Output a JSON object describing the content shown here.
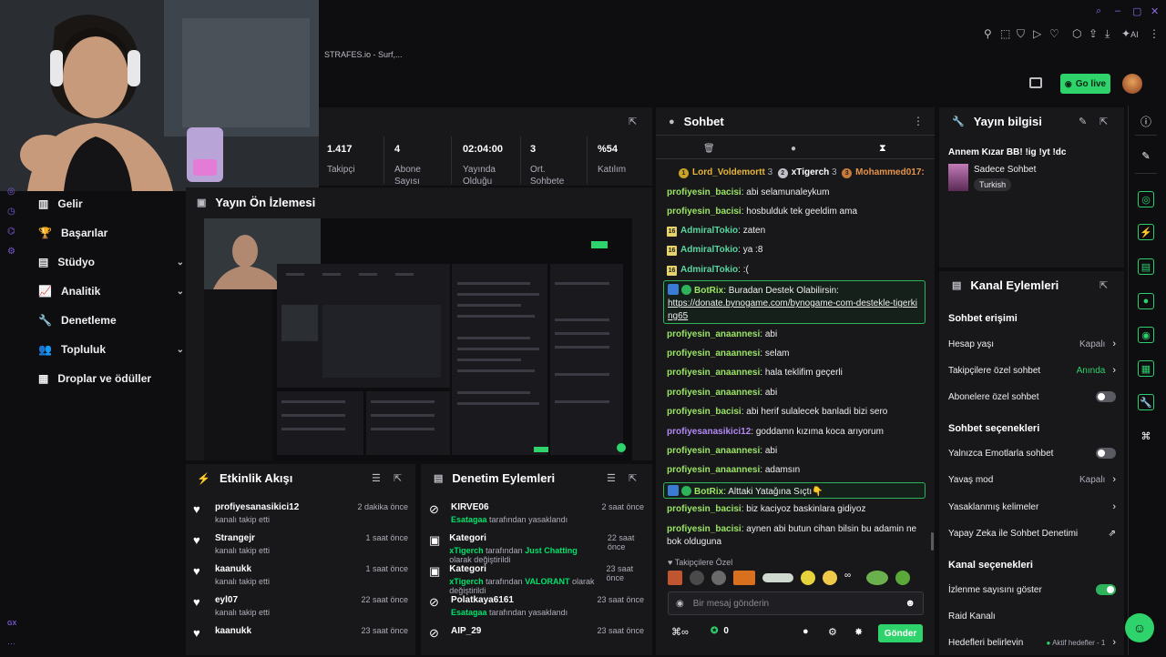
{
  "topbar": {
    "tab_title": "STRAFES.io - Surf,...",
    "ai_label": "AI",
    "go_live": "Go live"
  },
  "sidebar": {
    "items": [
      {
        "label": "Gelir",
        "icon": "bar-chart-icon"
      },
      {
        "label": "Başarılar",
        "icon": "trophy-icon"
      },
      {
        "label": "Stüdyo",
        "icon": "studio-icon"
      },
      {
        "label": "Analitik",
        "icon": "analytics-icon"
      },
      {
        "label": "Denetleme",
        "icon": "wrench-icon"
      },
      {
        "label": "Topluluk",
        "icon": "community-icon"
      },
      {
        "label": "Droplar ve ödüller",
        "icon": "gift-icon"
      }
    ],
    "footer": "GX"
  },
  "stats": [
    {
      "value": "1.417",
      "label": "Takipçi"
    },
    {
      "value": "4",
      "label": "Abone Sayısı"
    },
    {
      "value": "02:04:00",
      "label": "Yayında Olduğu"
    },
    {
      "value": "3",
      "label": "Ort. Sohbete"
    },
    {
      "value": "%54",
      "label": "Katılım"
    }
  ],
  "preview": {
    "title": "Yayın Ön İzlemesi"
  },
  "activity": {
    "title": "Etkinlik Akışı",
    "items": [
      {
        "name": "profiyesanasikici12",
        "action": "kanalı takip etti",
        "time": "2 dakika önce"
      },
      {
        "name": "Strangejr",
        "action": "kanalı takip etti",
        "time": "1 saat önce"
      },
      {
        "name": "kaanukk",
        "action": "kanalı takip etti",
        "time": "1 saat önce"
      },
      {
        "name": "eyl07",
        "action": "kanalı takip etti",
        "time": "22 saat önce"
      },
      {
        "name": "kaanukk",
        "action": "",
        "time": "23 saat önce"
      }
    ]
  },
  "moderation": {
    "title": "Denetim Eylemleri",
    "items": [
      {
        "name": "KIRVE06",
        "actor": "Esatagaa",
        "mid": " tarafından yasaklandı",
        "hl": "",
        "end": "",
        "time": "2 saat önce",
        "icon": "ban-icon"
      },
      {
        "name": "Kategori",
        "actor": "xTigerch",
        "mid": " tarafından ",
        "hl": "Just Chatting",
        "end": " olarak değiştirildi",
        "time": "22 saat önce",
        "icon": "category-icon"
      },
      {
        "name": "Kategori",
        "actor": "xTigerch",
        "mid": " tarafından ",
        "hl": "VALORANT",
        "end": " olarak değiştirildi",
        "time": "23 saat önce",
        "icon": "category-icon"
      },
      {
        "name": "Polatkaya6161",
        "actor": "Esatagaa",
        "mid": " tarafından yasaklandı",
        "hl": "",
        "end": "",
        "time": "23 saat önce",
        "icon": "ban-icon"
      },
      {
        "name": "AIP_29",
        "actor": "",
        "mid": "",
        "hl": "",
        "end": "",
        "time": "23 saat önce",
        "icon": "ban-icon"
      }
    ]
  },
  "chat": {
    "title": "Sohbet",
    "top_chatters": [
      {
        "rank": "1",
        "name": "Lord_Voldemortt",
        "count": "3"
      },
      {
        "rank": "2",
        "name": "xTigerch",
        "count": "3"
      },
      {
        "rank": "3",
        "name": "Mohammed017:",
        "count": ""
      }
    ],
    "messages": [
      {
        "user": "profiyesin_bacisi",
        "text": "abi selamunaleykum",
        "cls": "u1",
        "badge": ""
      },
      {
        "user": "profiyesin_bacisi",
        "text": "hosbulduk tek geeldim ama",
        "cls": "u1",
        "badge": ""
      },
      {
        "user": "AdmiralTokio",
        "text": "zaten",
        "cls": "u3",
        "badge": "16"
      },
      {
        "user": "AdmiralTokio",
        "text": "ya :8",
        "cls": "u3",
        "badge": "16"
      },
      {
        "user": "AdmiralTokio",
        "text": ":(",
        "cls": "u3",
        "badge": "16"
      },
      {
        "user": "profiyesin_anaannesi",
        "text": "abi",
        "cls": "u1",
        "badge": ""
      },
      {
        "user": "profiyesin_anaannesi",
        "text": "selam",
        "cls": "u1",
        "badge": ""
      },
      {
        "user": "profiyesin_anaannesi",
        "text": "hala teklifim geçerli",
        "cls": "u1",
        "badge": ""
      },
      {
        "user": "profiyesin_anaannesi",
        "text": "abi",
        "cls": "u1",
        "badge": ""
      },
      {
        "user": "profiyesin_bacisi",
        "text": "abi herif sulalecek banladi bizi sero",
        "cls": "u1",
        "badge": ""
      },
      {
        "user": "profiyesanasikici12",
        "text": "goddamn kızıma koca arıyorum",
        "cls": "u2",
        "badge": ""
      },
      {
        "user": "profiyesin_anaannesi",
        "text": "abi",
        "cls": "u1",
        "badge": ""
      },
      {
        "user": "profiyesin_anaannesi",
        "text": "adamsın",
        "cls": "u1",
        "badge": ""
      },
      {
        "user": "profiyesin_bacisi",
        "text": "biz kaciyoz baskinlara gidiyoz",
        "cls": "u1",
        "badge": ""
      },
      {
        "user": "profiyesin_bacisi",
        "text": "aynen abi butun cihan bilsin bu adamin ne bok olduguna",
        "cls": "u1",
        "badge": ""
      }
    ],
    "bot1": {
      "user": "BotRix",
      "text": "Buradan Destek Olabilirsin:",
      "link": "https://donate.bynogame.com/bynogame-com-destekle-tigerking65"
    },
    "bot2": {
      "user": "BotRix",
      "text": "Alttaki Yatağına Sıçtı👇"
    },
    "followers_only": "Takipçilere Özel",
    "input_placeholder": "Bir mesaj gönderin",
    "points": "0",
    "send": "Gönder"
  },
  "stream_info": {
    "title": "Yayın bilgisi",
    "stream_title": "Annem Kızar BB! !ig !yt !dc",
    "category": "Sadece Sohbet",
    "language": "Turkish"
  },
  "channel_actions": {
    "title": "Kanal Eylemleri",
    "chat_access": "Sohbet erişimi",
    "account_age": "Hesap yaşı",
    "account_age_val": "Kapalı",
    "followers_chat": "Takipçilere özel sohbet",
    "followers_chat_val": "Anında",
    "subs_chat": "Abonelere özel sohbet",
    "chat_options": "Sohbet seçenekleri",
    "emote_only": "Yalnızca Emotlarla sohbet",
    "slow_mode": "Yavaş mod",
    "slow_mode_val": "Kapalı",
    "banned_words": "Yasaklanmış kelimeler",
    "ai_moderation": "Yapay Zeka ile Sohbet Denetimi",
    "channel_options": "Kanal seçenekleri",
    "show_viewers": "İzlenme sayısını göster",
    "raid": "Raid Kanalı",
    "goals": "Hedefleri belirlevin",
    "goals_val": "Aktif hedefler - 1"
  },
  "colors": {
    "accent": "#00e36b",
    "bg": "#0e0e10",
    "panel": "#18181b"
  }
}
